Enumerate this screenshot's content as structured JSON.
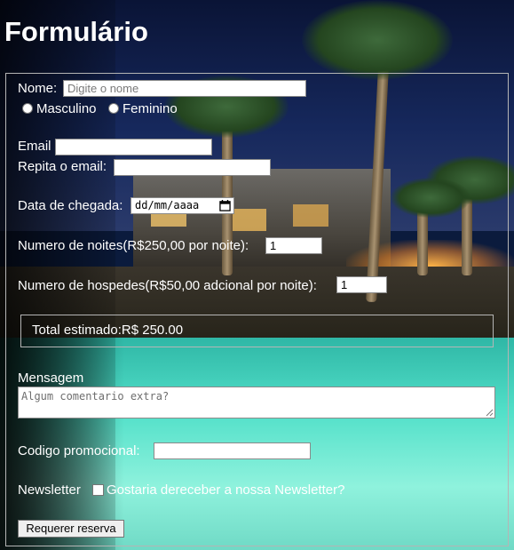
{
  "page": {
    "title": "Formulário"
  },
  "form": {
    "nome": {
      "label": "Nome:",
      "placeholder": "Digite o  nome"
    },
    "gender": {
      "options": [
        "Masculino",
        "Feminino"
      ]
    },
    "email": {
      "label": "Email",
      "value": ""
    },
    "repeat_email": {
      "label": "Repita o email:",
      "value": ""
    },
    "arrival": {
      "label": "Data de chegada:",
      "placeholder": "dd/mm/aaaa",
      "icon": "calendar-icon"
    },
    "nights": {
      "label": "Numero de noites(R$250,00 por noite):",
      "value": "1"
    },
    "guests": {
      "label": "Numero de hospedes(R$50,00 adcional por noite):",
      "value": "1"
    },
    "total": {
      "label": "Total estimado:",
      "value": "R$ 250.00"
    },
    "message": {
      "label": "Mensagem",
      "placeholder": "Algum comentario extra?"
    },
    "promo": {
      "label": "Codigo promocional:",
      "value": ""
    },
    "newsletter": {
      "label": "Newsletter",
      "checkbox_label": "Gostaria dereceber a nossa Newsletter?"
    },
    "submit": {
      "label": "Requerer reserva"
    }
  },
  "colors": {
    "text": "#ffffff",
    "frame_border": "#b5b5b5",
    "pool": "#52e0c9",
    "sky": "#16285c"
  }
}
